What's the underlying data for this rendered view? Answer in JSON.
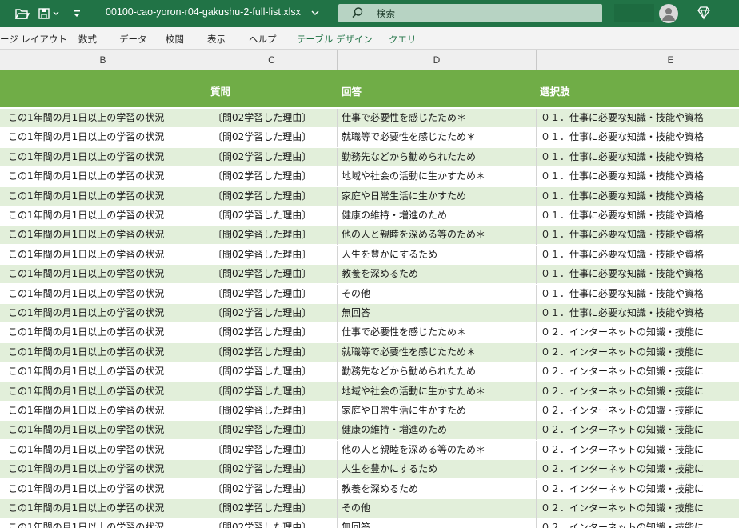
{
  "titlebar": {
    "filename": "00100-cao-yoron-r04-gakushu-2-full-list.xlsx",
    "search_placeholder": "検索",
    "icons": [
      "open-folder-icon",
      "save-options-icon",
      "customize-qat-icon",
      "search-icon",
      "account-icon",
      "premium-diamond-icon"
    ],
    "bg_color": "#217346"
  },
  "ribbon": {
    "tabs": [
      "ージ レイアウト",
      "数式",
      "データ",
      "校閲",
      "表示",
      "ヘルプ",
      "テーブル デザイン",
      "クエリ"
    ]
  },
  "columns": [
    "B",
    "C",
    "D",
    "E"
  ],
  "table": {
    "header_color": "#70ad47",
    "band_color": "#e2efda",
    "headers": [
      "",
      "質問",
      "回答",
      "選択肢"
    ],
    "rows": [
      [
        "この1年間の月1日以上の学習の状況",
        "〔問02学習した理由〕",
        "仕事で必要性を感じたため＊",
        "０１．仕事に必要な知識・技能や資格"
      ],
      [
        "この1年間の月1日以上の学習の状況",
        "〔問02学習した理由〕",
        "就職等で必要性を感じたため＊",
        "０１．仕事に必要な知識・技能や資格"
      ],
      [
        "この1年間の月1日以上の学習の状況",
        "〔問02学習した理由〕",
        "勤務先などから勧められたため",
        "０１．仕事に必要な知識・技能や資格"
      ],
      [
        "この1年間の月1日以上の学習の状況",
        "〔問02学習した理由〕",
        "地域や社会の活動に生かすため＊",
        "０１．仕事に必要な知識・技能や資格"
      ],
      [
        "この1年間の月1日以上の学習の状況",
        "〔問02学習した理由〕",
        "家庭や日常生活に生かすため",
        "０１．仕事に必要な知識・技能や資格"
      ],
      [
        "この1年間の月1日以上の学習の状況",
        "〔問02学習した理由〕",
        "健康の維持・増進のため",
        "０１．仕事に必要な知識・技能や資格"
      ],
      [
        "この1年間の月1日以上の学習の状況",
        "〔問02学習した理由〕",
        "他の人と親睦を深める等のため＊",
        "０１．仕事に必要な知識・技能や資格"
      ],
      [
        "この1年間の月1日以上の学習の状況",
        "〔問02学習した理由〕",
        "人生を豊かにするため",
        "０１．仕事に必要な知識・技能や資格"
      ],
      [
        "この1年間の月1日以上の学習の状況",
        "〔問02学習した理由〕",
        "教養を深めるため",
        "０１．仕事に必要な知識・技能や資格"
      ],
      [
        "この1年間の月1日以上の学習の状況",
        "〔問02学習した理由〕",
        "その他",
        "０１．仕事に必要な知識・技能や資格"
      ],
      [
        "この1年間の月1日以上の学習の状況",
        "〔問02学習した理由〕",
        "無回答",
        "０１．仕事に必要な知識・技能や資格"
      ],
      [
        "この1年間の月1日以上の学習の状況",
        "〔問02学習した理由〕",
        "仕事で必要性を感じたため＊",
        "０２．インターネットの知識・技能に"
      ],
      [
        "この1年間の月1日以上の学習の状況",
        "〔問02学習した理由〕",
        "就職等で必要性を感じたため＊",
        "０２．インターネットの知識・技能に"
      ],
      [
        "この1年間の月1日以上の学習の状況",
        "〔問02学習した理由〕",
        "勤務先などから勧められたため",
        "０２．インターネットの知識・技能に"
      ],
      [
        "この1年間の月1日以上の学習の状況",
        "〔問02学習した理由〕",
        "地域や社会の活動に生かすため＊",
        "０２．インターネットの知識・技能に"
      ],
      [
        "この1年間の月1日以上の学習の状況",
        "〔問02学習した理由〕",
        "家庭や日常生活に生かすため",
        "０２．インターネットの知識・技能に"
      ],
      [
        "この1年間の月1日以上の学習の状況",
        "〔問02学習した理由〕",
        "健康の維持・増進のため",
        "０２．インターネットの知識・技能に"
      ],
      [
        "この1年間の月1日以上の学習の状況",
        "〔問02学習した理由〕",
        "他の人と親睦を深める等のため＊",
        "０２．インターネットの知識・技能に"
      ],
      [
        "この1年間の月1日以上の学習の状況",
        "〔問02学習した理由〕",
        "人生を豊かにするため",
        "０２．インターネットの知識・技能に"
      ],
      [
        "この1年間の月1日以上の学習の状況",
        "〔問02学習した理由〕",
        "教養を深めるため",
        "０２．インターネットの知識・技能に"
      ],
      [
        "この1年間の月1日以上の学習の状況",
        "〔問02学習した理由〕",
        "その他",
        "０２．インターネットの知識・技能に"
      ],
      [
        "この1年間の月1日以上の学習の状況",
        "〔問02学習した理由〕",
        "無回答",
        "０２．インターネットの知識・技能に"
      ]
    ]
  }
}
